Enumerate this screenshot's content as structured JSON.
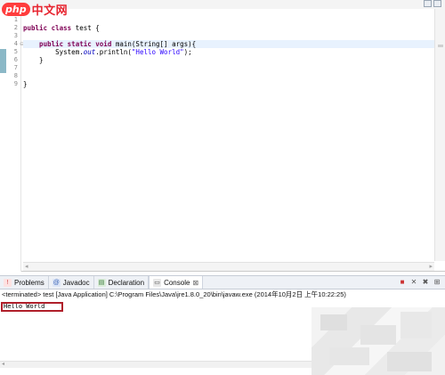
{
  "logo": {
    "prefix": "php",
    "suffix": "中文网"
  },
  "editor": {
    "line_numbers": [
      "1",
      "2",
      "3",
      "4",
      "5",
      "6",
      "7",
      "8",
      "9"
    ],
    "lines": [
      {
        "kw": "",
        "text": ""
      },
      {
        "kw": "public class",
        "text": " test {"
      },
      {
        "kw": "",
        "text": ""
      },
      {
        "kw": "    public static void",
        "text": " main(String[] args){"
      },
      {
        "kw": "",
        "text": "        System.out.println(\"Hello World\");"
      },
      {
        "kw": "",
        "text": "    }"
      },
      {
        "kw": "",
        "text": ""
      },
      {
        "kw": "",
        "text": ""
      },
      {
        "kw": "",
        "text": "}"
      }
    ],
    "line5": {
      "pre": "        System.",
      "field": "out",
      "mid": ".println(",
      "string": "\"Hello World\"",
      "post": ");"
    }
  },
  "panel": {
    "tabs": [
      {
        "label": "Problems",
        "icon": "problems-icon",
        "color": "#c44"
      },
      {
        "label": "Javadoc",
        "icon": "javadoc-icon",
        "color": "#3a63b5"
      },
      {
        "label": "Declaration",
        "icon": "declaration-icon",
        "color": "#3a7a3a"
      },
      {
        "label": "Console",
        "icon": "console-icon",
        "color": "#444",
        "close": "⊠"
      }
    ],
    "console_header": "<terminated> test [Java Application] C:\\Program Files\\Java\\jre1.8.0_20\\bin\\javaw.exe (2014年10月2日 上午10:22:25)",
    "console_output": "Hello World"
  },
  "colors": {
    "accent_red": "#b01f2a",
    "keyword": "#7f0055",
    "string": "#2a00ff"
  }
}
